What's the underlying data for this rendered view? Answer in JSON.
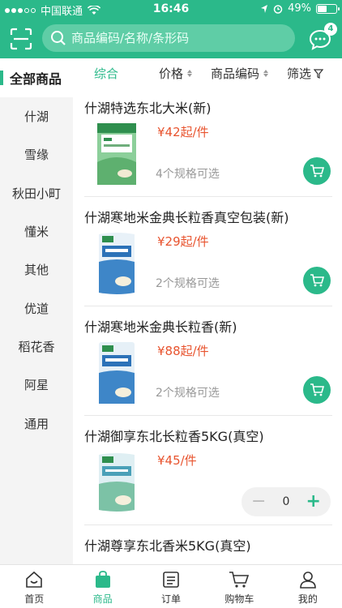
{
  "status_bar": {
    "carrier": "中国联通",
    "time": "16:46",
    "battery": "49%",
    "battery_level": 0.49
  },
  "search": {
    "placeholder": "商品编码/名称/条形码"
  },
  "messages": {
    "badge": "4"
  },
  "sidebar": {
    "all_label": "全部商品",
    "items": [
      "什湖",
      "雪缘",
      "秋田小町",
      "懂米",
      "其他",
      "优道",
      "稻花香",
      "阿星",
      "通用"
    ]
  },
  "sort_bar": {
    "comprehensive": "综合",
    "price": "价格",
    "code": "商品编码",
    "filter": "筛选"
  },
  "products": [
    {
      "name": "什湖特选东北大米(新)",
      "price": "¥42起/件",
      "spec": "4个规格可选"
    },
    {
      "name": "什湖寒地米金典长粒香真空包装(新)",
      "price": "¥29起/件",
      "spec": "2个规格可选"
    },
    {
      "name": "什湖寒地米金典长粒香(新)",
      "price": "¥88起/件",
      "spec": "2个规格可选"
    },
    {
      "name": "什湖御享东北长粒香5KG(真空)",
      "price": "¥45/件",
      "qty": "0"
    },
    {
      "name": "什湖尊享东北香米5KG(真空)"
    }
  ],
  "tabbar": {
    "items": [
      "首页",
      "商品",
      "订单",
      "购物车",
      "我的"
    ]
  },
  "colors": {
    "brand": "#2bb98a",
    "price": "#e8542f"
  }
}
